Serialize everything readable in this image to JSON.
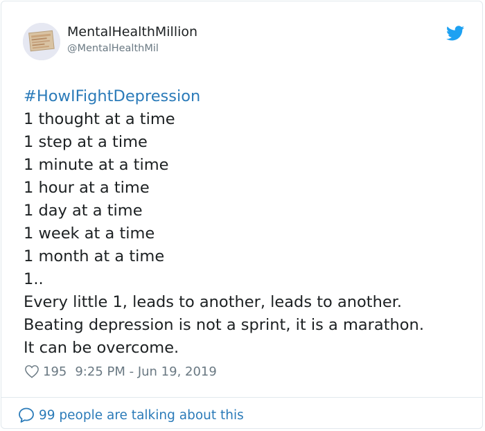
{
  "user": {
    "name": "MentalHealthMillion",
    "handle": "@MentalHealthMil"
  },
  "tweet": {
    "hashtag": "#HowIFightDepression",
    "lines": [
      "1 thought at a time",
      "1 step at a time",
      "1 minute at a time",
      "1 hour at a time",
      "1 day at a time",
      "1 week at a time",
      "1 month at a time",
      "1..",
      "Every little 1, leads to another, leads to another.",
      "Beating depression is not a sprint, it is a marathon.",
      "It can be overcome."
    ]
  },
  "meta": {
    "likes": "195",
    "timestamp": "9:25 PM - Jun 19, 2019"
  },
  "footer": {
    "talking": "99 people are talking about this"
  },
  "icons": {
    "brand": "twitter-bird-icon",
    "like": "heart-icon",
    "replies": "speech-bubble-icon"
  },
  "colors": {
    "link": "#2b7bb9",
    "brand": "#1da1f2",
    "text": "#1c2022",
    "muted": "#697882",
    "border": "#e1e8ed"
  }
}
